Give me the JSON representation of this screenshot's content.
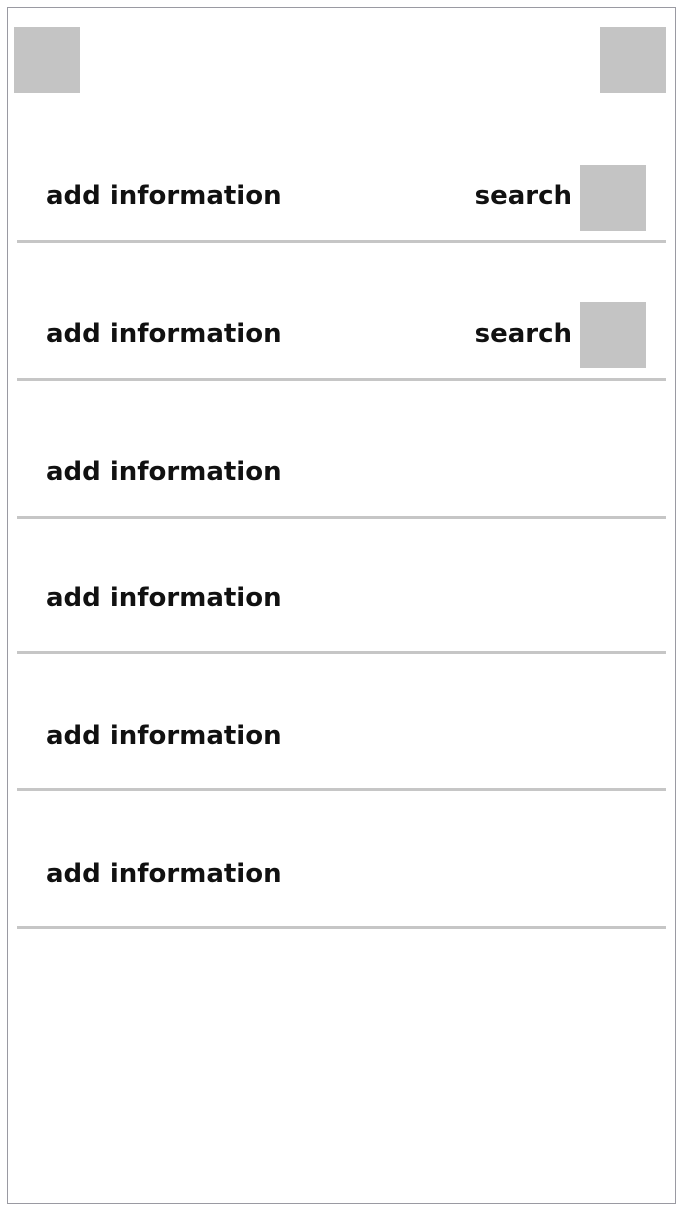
{
  "header": {
    "left_button_icon": "placeholder-square-icon",
    "right_button_icon": "placeholder-square-icon"
  },
  "rows": [
    {
      "label": "add information",
      "search_label": "search"
    },
    {
      "label": "add information",
      "search_label": "search"
    },
    {
      "label": "add information"
    },
    {
      "label": "add information"
    },
    {
      "label": "add information"
    },
    {
      "label": "add information"
    }
  ],
  "colors": {
    "placeholder": "#c4c4c4",
    "divider": "#c6c6c6",
    "frame_border": "#9a9aa2",
    "text": "#111111"
  }
}
